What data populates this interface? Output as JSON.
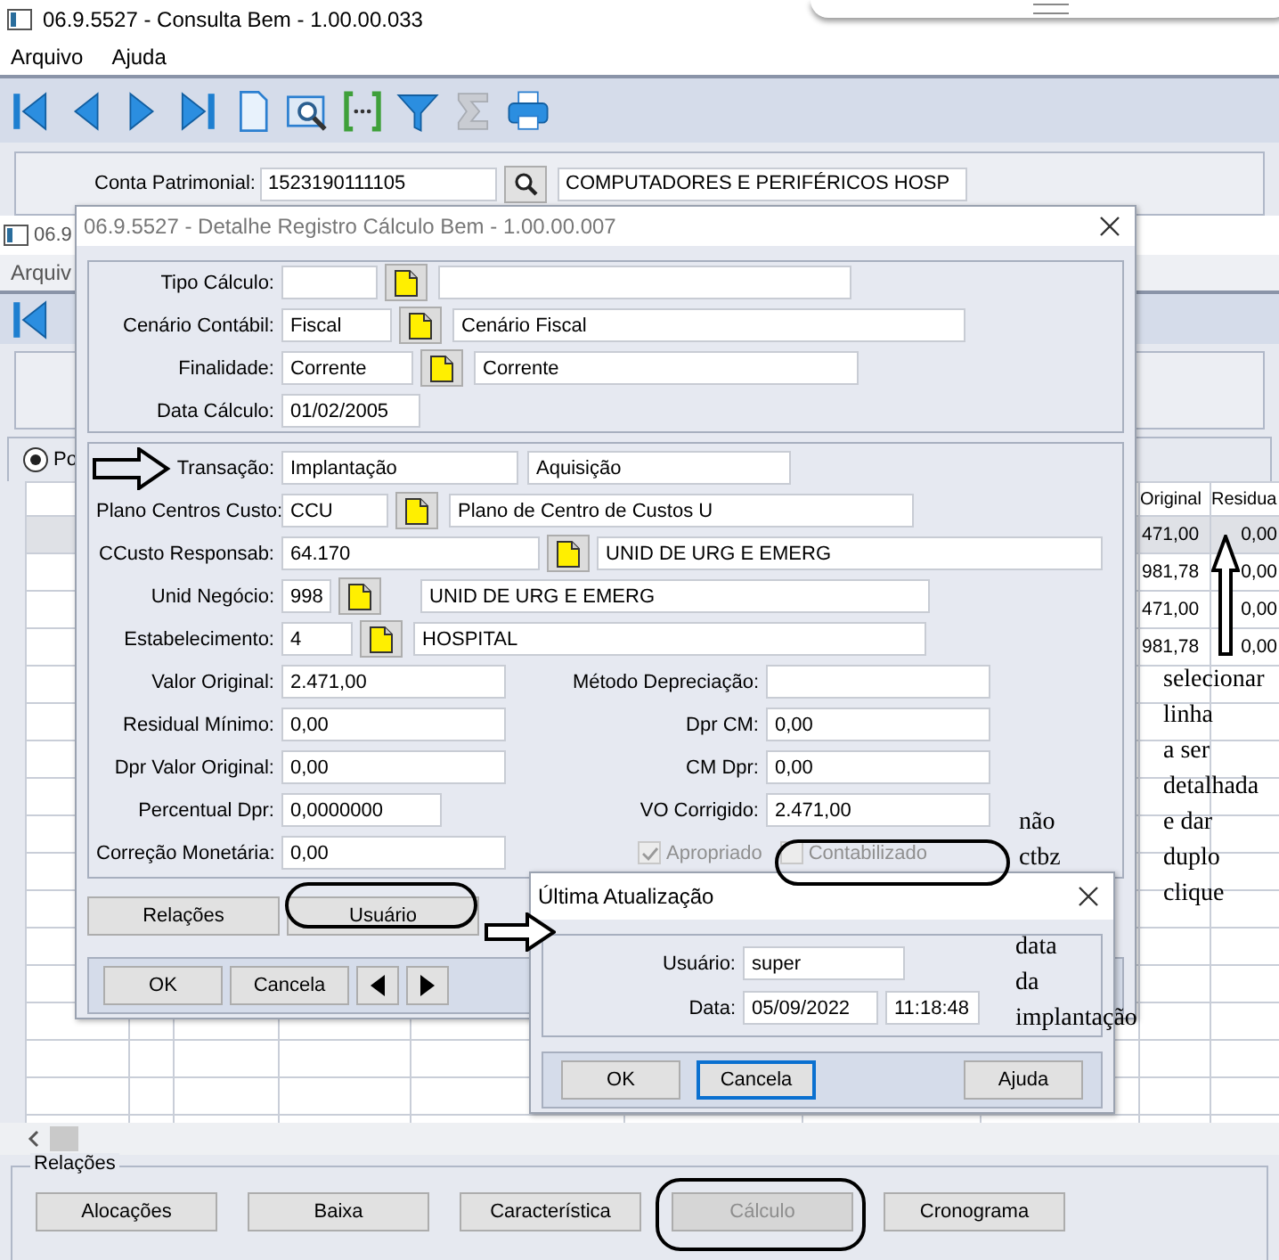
{
  "main_window": {
    "title": "06.9.5527 - Consulta Bem - 1.00.00.033",
    "menu": [
      "Arquivo",
      "Ajuda"
    ],
    "conta_patrimonial": {
      "label": "Conta Patrimonial:",
      "value": "1523190111105",
      "description": "COMPUTADORES E PERIFÉRICOS HOSP"
    }
  },
  "back_window": {
    "title": "06.9",
    "menu": [
      "Arquiv"
    ],
    "radio": {
      "label": "Po",
      "selected": true
    },
    "grid": {
      "columns": [
        "Original",
        "Residua"
      ],
      "rows": [
        {
          "cells": [
            "471,00",
            "0,00"
          ],
          "selected": true
        },
        {
          "cells": [
            "981,78",
            "0,00"
          ],
          "selected": false
        },
        {
          "cells": [
            "471,00",
            "0,00"
          ],
          "selected": false
        },
        {
          "cells": [
            "981,78",
            "0,00"
          ],
          "selected": false
        }
      ]
    }
  },
  "relacoes": {
    "title": "Relações",
    "buttons": [
      {
        "label": "Alocações",
        "disabled": false
      },
      {
        "label": "Baixa",
        "disabled": false
      },
      {
        "label": "Característica",
        "disabled": false
      },
      {
        "label": "Cálculo",
        "disabled": true
      },
      {
        "label": "Cronograma",
        "disabled": false
      }
    ]
  },
  "detail_dialog": {
    "title": "06.9.5527 - Detalhe Registro Cálculo Bem - 1.00.00.007",
    "header_fields": [
      {
        "kind": "lookup",
        "label": "Tipo Cálculo:"
      },
      {
        "kind": "lookup",
        "label": "Cenário Contábil:",
        "code": "Fiscal",
        "description": "Cenário Fiscal"
      },
      {
        "kind": "lookup",
        "label": "Finalidade:",
        "code": "Corrente",
        "description": "Corrente"
      },
      {
        "kind": "date",
        "label": "Data Cálculo:",
        "code": "01/02/2005"
      }
    ],
    "fields": [
      {
        "kind": "pair",
        "label": "Transação:",
        "code": "Implantação",
        "description": "Aquisição"
      },
      {
        "kind": "lookup",
        "label": "Plano Centros Custo:",
        "code": "CCU",
        "description": "Plano de Centro de Custos U"
      },
      {
        "kind": "lookup",
        "label": "CCusto Responsab:",
        "code": "64.170",
        "description": "UNID DE URG E EMERG"
      },
      {
        "kind": "lookup",
        "label": "Unid Negócio:",
        "code": "998",
        "description": "UNID DE URG E EMERG"
      },
      {
        "kind": "lookup",
        "label": "Estabelecimento:",
        "code": "4",
        "description": "HOSPITAL"
      }
    ],
    "values_left": [
      {
        "label": "Valor Original:",
        "value": "2.471,00"
      },
      {
        "label": "Residual Mínimo:",
        "value": "0,00"
      },
      {
        "label": "Dpr Valor Original:",
        "value": "0,00"
      },
      {
        "label": "Percentual Dpr:",
        "value": "0,0000000"
      },
      {
        "label": "Correção Monetária:",
        "value": "0,00"
      }
    ],
    "values_right": [
      {
        "label": "Método Depreciação:"
      },
      {
        "label": "Dpr CM:",
        "value": "0,00"
      },
      {
        "label": "CM Dpr:",
        "value": "0,00"
      },
      {
        "label": "VO Corrigido:",
        "value": "2.471,00"
      }
    ],
    "checkboxes": [
      {
        "label": "Apropriado",
        "checked": true,
        "disabled": true
      },
      {
        "label": "Contabilizado",
        "checked": false,
        "disabled": true
      }
    ],
    "action_buttons": [
      "Relações",
      "Usuário"
    ],
    "footer_buttons": [
      "OK",
      "Cancela"
    ]
  },
  "update_dialog": {
    "title": "Última Atualização",
    "usuario": {
      "label": "Usuário:",
      "value": "super"
    },
    "data": {
      "label": "Data:",
      "date": "05/09/2022",
      "time": "11:18:48"
    },
    "buttons": [
      {
        "label": "OK",
        "selected": false
      },
      {
        "label": "Cancela",
        "selected": true
      },
      {
        "label": "Ajuda",
        "selected": false
      }
    ]
  },
  "annotations": [
    {
      "lines": [
        "selecionar",
        "linha",
        "a ser",
        "detalhada",
        "e dar",
        "duplo",
        "clique"
      ]
    },
    {
      "lines": [
        "não",
        "ctbz"
      ]
    },
    {
      "lines": [
        "data",
        "da",
        "implantação"
      ]
    }
  ]
}
